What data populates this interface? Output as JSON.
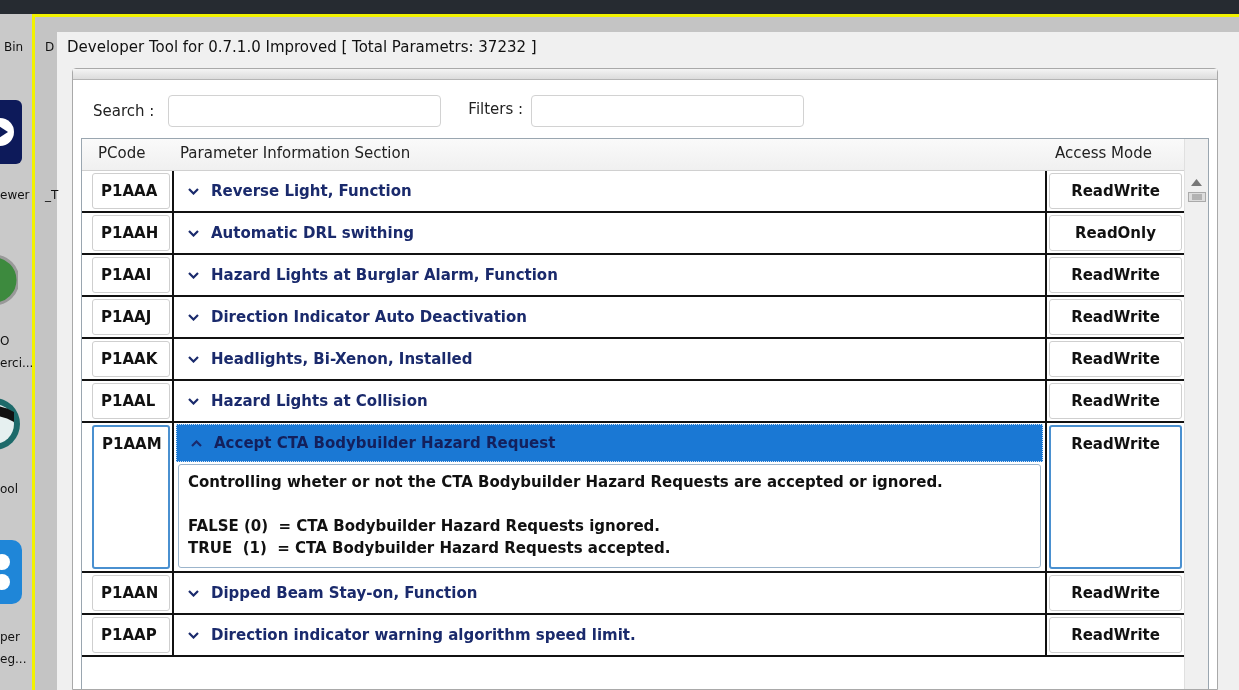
{
  "desktop": {
    "icons": [
      {
        "label": "Bin"
      },
      {
        "label": "D"
      },
      {
        "label": "ewer"
      },
      {
        "label": "_T"
      },
      {
        "label": "O"
      },
      {
        "label": "erci..."
      },
      {
        "label": "ool"
      },
      {
        "label": "per"
      },
      {
        "label": "eg..."
      }
    ]
  },
  "window": {
    "title": "Developer Tool for 0.7.1.0 Improved [ Total Parametrs: 37232 ]"
  },
  "search": {
    "label": "Search :"
  },
  "filters": {
    "label": "Filters :"
  },
  "table": {
    "columns": [
      "PCode",
      "Parameter Information Section",
      "Access Mode"
    ],
    "rows": [
      {
        "pcode": "P1AAA",
        "title": "Reverse Light, Function",
        "access": "ReadWrite",
        "expanded": false,
        "selected": false
      },
      {
        "pcode": "P1AAH",
        "title": "Automatic DRL swithing",
        "access": "ReadOnly",
        "expanded": false,
        "selected": false
      },
      {
        "pcode": "P1AAI",
        "title": "Hazard Lights at Burglar Alarm, Function",
        "access": "ReadWrite",
        "expanded": false,
        "selected": false
      },
      {
        "pcode": "P1AAJ",
        "title": "Direction Indicator Auto Deactivation",
        "access": "ReadWrite",
        "expanded": false,
        "selected": false
      },
      {
        "pcode": "P1AAK",
        "title": "Headlights, Bi-Xenon, Installed",
        "access": "ReadWrite",
        "expanded": false,
        "selected": false
      },
      {
        "pcode": "P1AAL",
        "title": "Hazard Lights at Collision",
        "access": "ReadWrite",
        "expanded": false,
        "selected": false
      },
      {
        "pcode": "P1AAM",
        "title": "Accept CTA Bodybuilder Hazard Request",
        "access": "ReadWrite",
        "expanded": true,
        "selected": true,
        "description": "Controlling wheter or not the CTA Bodybuilder Hazard Requests are accepted or ignored.\n\nFALSE (0)  = CTA Bodybuilder Hazard Requests ignored.\nTRUE  (1)  = CTA Bodybuilder Hazard Requests accepted."
      },
      {
        "pcode": "P1AAN",
        "title": "Dipped Beam Stay-on, Function",
        "access": "ReadWrite",
        "expanded": false,
        "selected": false
      },
      {
        "pcode": "P1AAP",
        "title": "Direction indicator warning algorithm speed limit.",
        "access": "ReadWrite",
        "expanded": false,
        "selected": false
      }
    ]
  }
}
